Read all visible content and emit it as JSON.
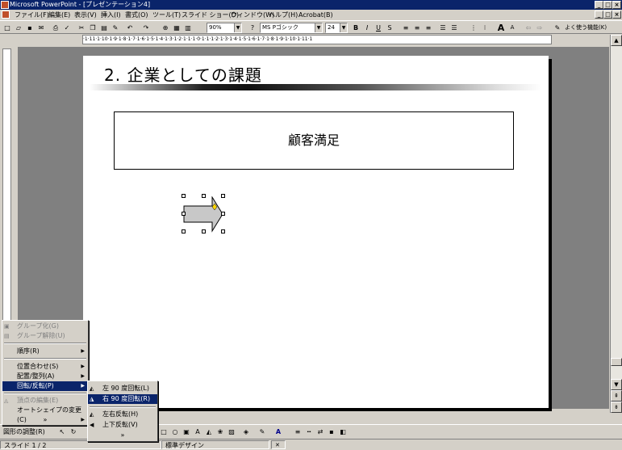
{
  "window": {
    "title": "Microsoft PowerPoint - [プレゼンテーション4]"
  },
  "menubar": {
    "items": [
      "ファイル(F)",
      "編集(E)",
      "表示(V)",
      "挿入(I)",
      "書式(O)",
      "ツール(T)",
      "スライド ショー(D)",
      "ウィンドウ(W)",
      "ヘルプ(H)",
      "Acrobat(B)"
    ]
  },
  "toolbar": {
    "zoom": "90%",
    "font": "MS Pゴシック",
    "size": "24",
    "common_tasks": "よく使う機能(K)"
  },
  "slide": {
    "title": "2. 企業としての課題",
    "box_text": "顧客満足"
  },
  "ruler": {
    "h_ticks": "·1·11·1·10·1·9·1·8·1·7·1·6·1·5·1·4·1·3·1·2·1·1·1·0·1·1·1·2·1·3·1·4·1·5·1·6·1·7·1·8·1·9·1·10·1·11·1"
  },
  "context_menu": {
    "items": [
      {
        "label": "グループ化(G)",
        "disabled": true
      },
      {
        "label": "グループ解除(U)",
        "disabled": true
      },
      {
        "label": "順序(R)",
        "disabled": false
      },
      {
        "label": "位置合わせ(S)",
        "disabled": false
      },
      {
        "label": "配置/整列(A)",
        "disabled": false
      },
      {
        "label": "回転/反転(P)",
        "disabled": false
      },
      {
        "label": "頂点の編集(E)",
        "disabled": true
      },
      {
        "label": "オートシェイプの変更(C)",
        "disabled": false
      }
    ],
    "more": "»"
  },
  "submenu": {
    "items": [
      "左 90 度回転(L)",
      "右 90 度回転(R)",
      "左右反転(H)",
      "上下反転(V)"
    ],
    "more": "»"
  },
  "drawbar": {
    "draw_label": "図形の調整(R)"
  },
  "statusbar": {
    "slide": "スライド 1 / 2",
    "design": "標準デザイン"
  }
}
